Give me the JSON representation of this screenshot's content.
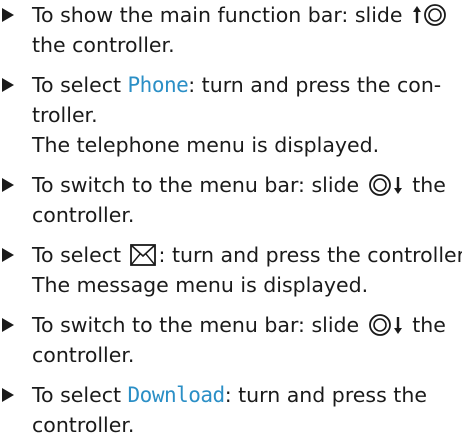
{
  "steps": [
    {
      "lines": [
        {
          "before": "To show the main function bar: slide ",
          "icon": "slide-up-controller-icon",
          "after": ""
        },
        {
          "before": "the controller.",
          "after": ""
        }
      ]
    },
    {
      "lines": [
        {
          "before": "To select ",
          "keyword": "Phone",
          "after": ": turn and press the con-"
        },
        {
          "before": "troller.",
          "after": ""
        },
        {
          "before": "The telephone menu is displayed.",
          "after": ""
        }
      ]
    },
    {
      "lines": [
        {
          "before": "To switch to the menu bar: slide ",
          "icon": "slide-down-controller-icon",
          "after": " the"
        },
        {
          "before": "controller.",
          "after": ""
        }
      ]
    },
    {
      "lines": [
        {
          "before": "To select ",
          "icon": "envelope-icon",
          "after": ": turn and press the controller."
        },
        {
          "before": "The message menu is displayed.",
          "after": ""
        }
      ]
    },
    {
      "lines": [
        {
          "before": "To switch to the menu bar: slide ",
          "icon": "slide-down-controller-icon",
          "after": " the"
        },
        {
          "before": "controller.",
          "after": ""
        }
      ]
    },
    {
      "lines": [
        {
          "before": "To select ",
          "keyword": "Download",
          "after": ": turn and press the"
        },
        {
          "before": "controller.",
          "after": ""
        }
      ]
    }
  ],
  "colors": {
    "text": "#1a1a1a",
    "keyword": "#2b8fc6"
  }
}
